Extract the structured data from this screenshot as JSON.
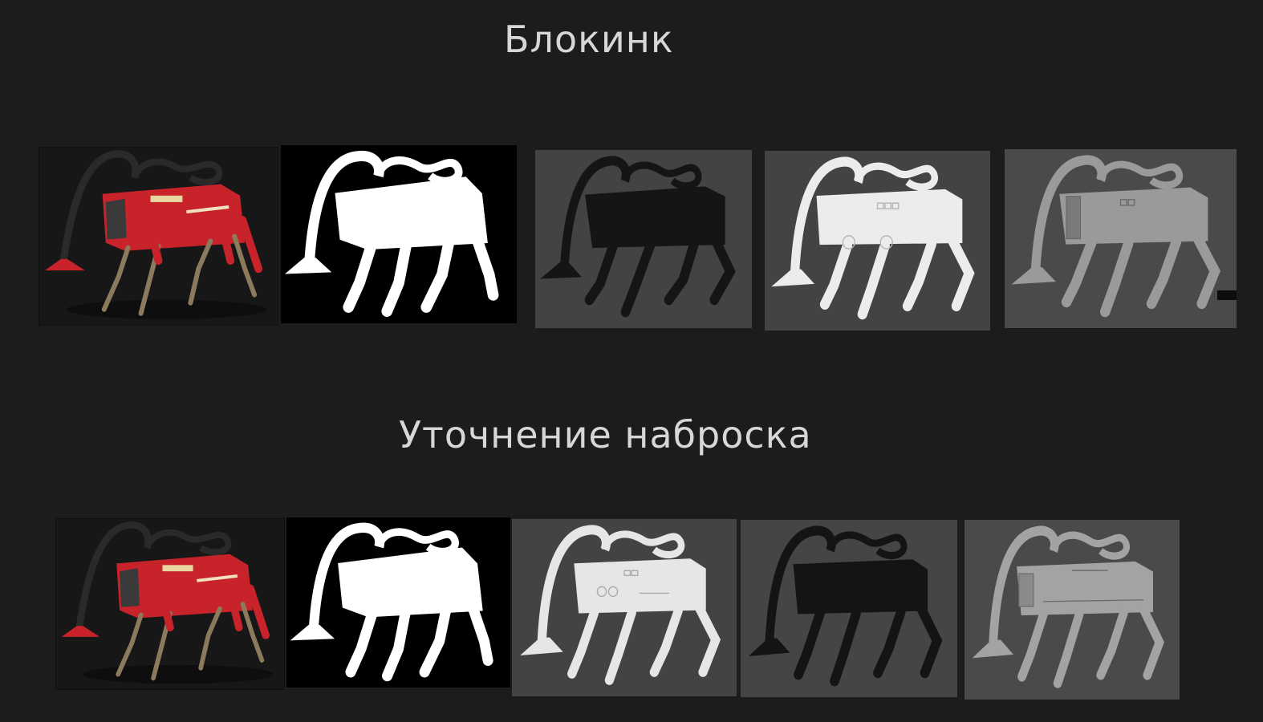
{
  "sections": [
    {
      "title": "Блокинк",
      "renders": [
        {
          "name": "beauty-render",
          "description": "red robot dog with hose"
        },
        {
          "name": "silhouette-mask",
          "fill": "#ffffff",
          "background": "#000000"
        },
        {
          "name": "dark-silhouette",
          "fill": "#151515",
          "background": "#434343"
        },
        {
          "name": "light-clay",
          "fill": "#ececec",
          "background": "#444444"
        },
        {
          "name": "grey-clay",
          "fill": "#9a9a9a",
          "background": "#4a4a4a"
        }
      ]
    },
    {
      "title": "Уточнение наброска",
      "renders": [
        {
          "name": "beauty-render",
          "description": "red robot dog with hose"
        },
        {
          "name": "silhouette-mask",
          "fill": "#ffffff",
          "background": "#000000"
        },
        {
          "name": "light-clay",
          "fill": "#e6e6e6",
          "background": "#434343"
        },
        {
          "name": "dark-silhouette",
          "fill": "#141414",
          "background": "#454545"
        },
        {
          "name": "grey-clay",
          "fill": "#a3a3a3",
          "background": "#4a4a4a"
        }
      ]
    }
  ],
  "colors": {
    "page_background": "#1c1c1c",
    "heading_text": "#d7d7d7",
    "robot_red": "#c8222b",
    "robot_frame": "#c9b08a"
  }
}
